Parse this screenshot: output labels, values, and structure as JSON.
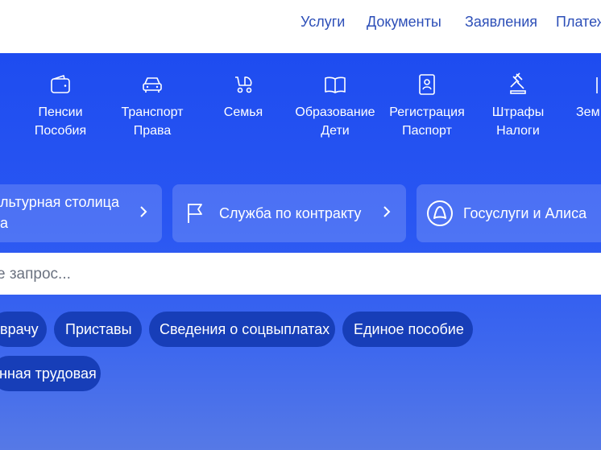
{
  "topnav": {
    "links": [
      "Услуги",
      "Документы",
      "Заявления",
      "Платеж"
    ]
  },
  "categories": [
    {
      "line1": "Пенсии",
      "line2": "Пособия",
      "icon": "wallet-icon"
    },
    {
      "line1": "Транспорт",
      "line2": "Права",
      "icon": "car-icon"
    },
    {
      "line1": "Семья",
      "line2": "",
      "icon": "stroller-icon"
    },
    {
      "line1": "Образование",
      "line2": "Дети",
      "icon": "book-icon"
    },
    {
      "line1": "Регистрация",
      "line2": "Паспорт",
      "icon": "passport-icon"
    },
    {
      "line1": "Штрафы",
      "line2": "Налоги",
      "icon": "gavel-icon"
    },
    {
      "line1": "Зем",
      "line2": "",
      "icon": "land-icon"
    }
  ],
  "promos": [
    {
      "line1": "льтурная столица",
      "line2": "а"
    },
    {
      "line1": "Служба по контракту",
      "line2": "",
      "icon": "flag-icon"
    },
    {
      "line1": "Госуслуги и Алиса",
      "line2": "",
      "icon": "alice-icon"
    }
  ],
  "search": {
    "placeholder": "е запрос..."
  },
  "chips": [
    "врачу",
    "Приставы",
    "Сведения о соцвыплатах",
    "Единое пособие",
    "нная трудовая"
  ],
  "colors": {
    "accent": "#1e4cf0",
    "chip_bg": "#173eb8",
    "nav_link": "#2d4fb8"
  }
}
